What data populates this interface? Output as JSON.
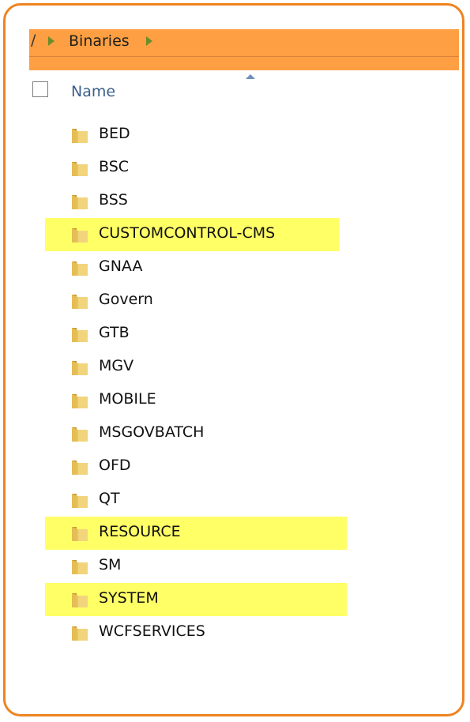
{
  "breadcrumb": {
    "tail": "/",
    "current": "Binaries"
  },
  "header": {
    "name_column": "Name"
  },
  "folders": [
    {
      "label": "BED",
      "highlighted": false
    },
    {
      "label": "BSC",
      "highlighted": false
    },
    {
      "label": "BSS",
      "highlighted": false
    },
    {
      "label": "CUSTOMCONTROL-CMS",
      "highlighted": true
    },
    {
      "label": "GNAA",
      "highlighted": false
    },
    {
      "label": "Govern",
      "highlighted": false
    },
    {
      "label": "GTB",
      "highlighted": false
    },
    {
      "label": "MGV",
      "highlighted": false
    },
    {
      "label": "MOBILE",
      "highlighted": false
    },
    {
      "label": "MSGOVBATCH",
      "highlighted": false
    },
    {
      "label": "OFD",
      "highlighted": false
    },
    {
      "label": "QT",
      "highlighted": false
    },
    {
      "label": "RESOURCE",
      "highlighted": true
    },
    {
      "label": "SM",
      "highlighted": false
    },
    {
      "label": "SYSTEM",
      "highlighted": true
    },
    {
      "label": "WCFSERVICES",
      "highlighted": false
    }
  ],
  "colors": {
    "frame_border": "#ee8420",
    "breadcrumb_bg": "#fd9f42",
    "highlight": "#ffff66",
    "folder": "#e8c15a"
  },
  "icons": {
    "folder": "folder-icon",
    "breadcrumb_separator": "chevron-right-icon",
    "sort": "sort-ascending-icon"
  }
}
